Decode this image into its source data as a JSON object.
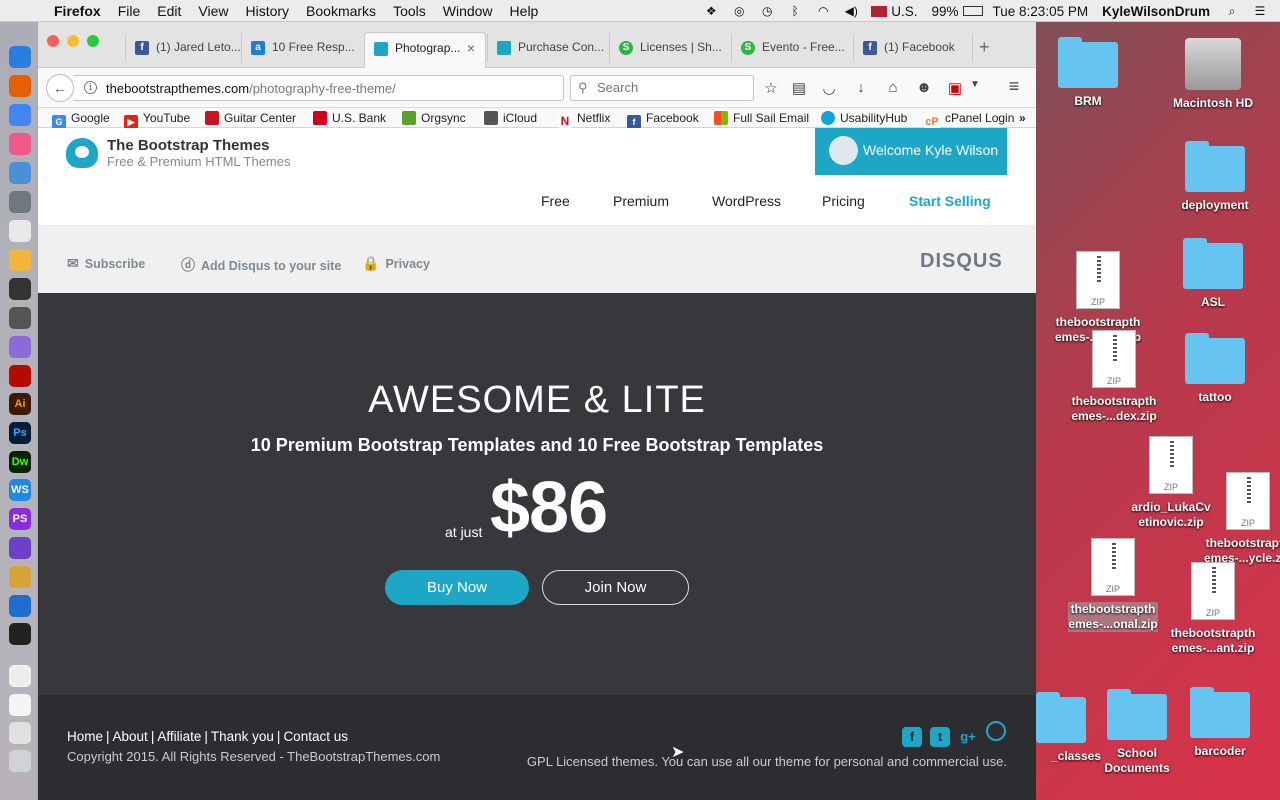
{
  "menubar": {
    "app_name": "Firefox",
    "items": [
      "File",
      "Edit",
      "View",
      "History",
      "Bookmarks",
      "Tools",
      "Window",
      "Help"
    ],
    "input_source": "U.S.",
    "battery": "99%",
    "clock": "Tue 8:23:05 PM",
    "user": "KyleWilsonDrum"
  },
  "browser": {
    "tabs": [
      {
        "title": "(1) Jared Leto...",
        "favicon": "facebook-icon",
        "color": "#3b5998"
      },
      {
        "title": "10 Free Resp...",
        "favicon": "a-icon",
        "color": "#1c7ed6"
      },
      {
        "title": "Photograp...",
        "favicon": "bootstrapthemes-icon",
        "color": "#1ea6c6",
        "active": true
      },
      {
        "title": "Purchase Con...",
        "favicon": "bootstrapthemes-icon",
        "color": "#1ea6c6"
      },
      {
        "title": "Licenses | Sh...",
        "favicon": "s-icon",
        "color": "#2fb344"
      },
      {
        "title": "Evento - Free...",
        "favicon": "s-icon",
        "color": "#2fb344"
      },
      {
        "title": "(1) Facebook",
        "favicon": "facebook-icon",
        "color": "#3b5998"
      }
    ],
    "url_host": "thebootstrapthemes.com",
    "url_path": "/photography-free-theme/",
    "search_placeholder": "Search",
    "bookmarks": [
      {
        "label": "Google",
        "icon": "google-icon",
        "color": "#4285f4"
      },
      {
        "label": "YouTube",
        "icon": "youtube-icon",
        "color": "#e62117"
      },
      {
        "label": "Guitar Center",
        "icon": "guitar-center-icon",
        "color": "#c4161c"
      },
      {
        "label": "U.S. Bank",
        "icon": "usbank-icon",
        "color": "#d2001e"
      },
      {
        "label": "Orgsync",
        "icon": "orgsync-icon",
        "color": "#5aa02c"
      },
      {
        "label": "iCloud",
        "icon": "apple-icon",
        "color": "#555555"
      },
      {
        "label": "Netflix",
        "icon": "netflix-icon",
        "color": "#e50914"
      },
      {
        "label": "Facebook",
        "icon": "facebook-icon",
        "color": "#3b5998"
      },
      {
        "label": "Full Sail Email",
        "icon": "microsoft-icon",
        "color": "#f25022"
      },
      {
        "label": "UsabilityHub",
        "icon": "usabilityhub-icon",
        "color": "#14a3d6"
      },
      {
        "label": "cPanel Login",
        "icon": "cpanel-icon",
        "color": "#ff6c2c"
      }
    ]
  },
  "site": {
    "brand_title": "The Bootstrap Themes",
    "brand_subtitle": "Free & Premium HTML Themes",
    "welcome": "Welcome Kyle Wilson",
    "nav": [
      "Free",
      "Premium",
      "WordPress",
      "Pricing",
      "Start Selling"
    ],
    "disqus": {
      "subscribe": "Subscribe",
      "add": "Add Disqus to your site",
      "privacy": "Privacy",
      "logo": "DISQUS"
    },
    "hero": {
      "title": "AWESOME & LITE",
      "subtitle": "10 Premium Bootstrap Templates and 10 Free Bootstrap Templates",
      "prefix": "at just",
      "price": "$86",
      "buy": "Buy Now",
      "join": "Join Now"
    },
    "footer": {
      "links": [
        "Home",
        "About",
        "Affiliate",
        "Thank you",
        "Contact us"
      ],
      "copyright": "Copyright 2015. All Rights Reserved - TheBootstrapThemes.com",
      "license": "GPL Licensed themes. You can use all our theme for personal and commercial use.",
      "social": [
        "facebook-icon",
        "twitter-icon",
        "google-plus-icon",
        "dribbble-icon"
      ]
    },
    "accent_color": "#1ea6c6"
  },
  "desktop": {
    "items": [
      {
        "label": "BRM",
        "type": "folder"
      },
      {
        "label": "Macintosh HD",
        "type": "drive"
      },
      {
        "label": "deployment",
        "type": "folder"
      },
      {
        "label": "thebootstrapth emes-...olio.zip",
        "type": "zip"
      },
      {
        "label": "ASL",
        "type": "folder"
      },
      {
        "label": "thebootstrapth emes-...dex.zip",
        "type": "zip"
      },
      {
        "label": "tattoo",
        "type": "folder"
      },
      {
        "label": "ardio_LukaCv etinovic.zip",
        "type": "zip"
      },
      {
        "label": "thebootstrapth emes-...ycle.zip",
        "type": "zip"
      },
      {
        "label": "thebootstrapth emes-...onal.zip",
        "type": "zip"
      },
      {
        "label": "thebootstrapth emes-...ant.zip",
        "type": "zip"
      },
      {
        "label": "School Documents",
        "type": "folder"
      },
      {
        "label": "barcoder",
        "type": "folder"
      },
      {
        "label": "_classes",
        "type": "folder"
      }
    ]
  }
}
